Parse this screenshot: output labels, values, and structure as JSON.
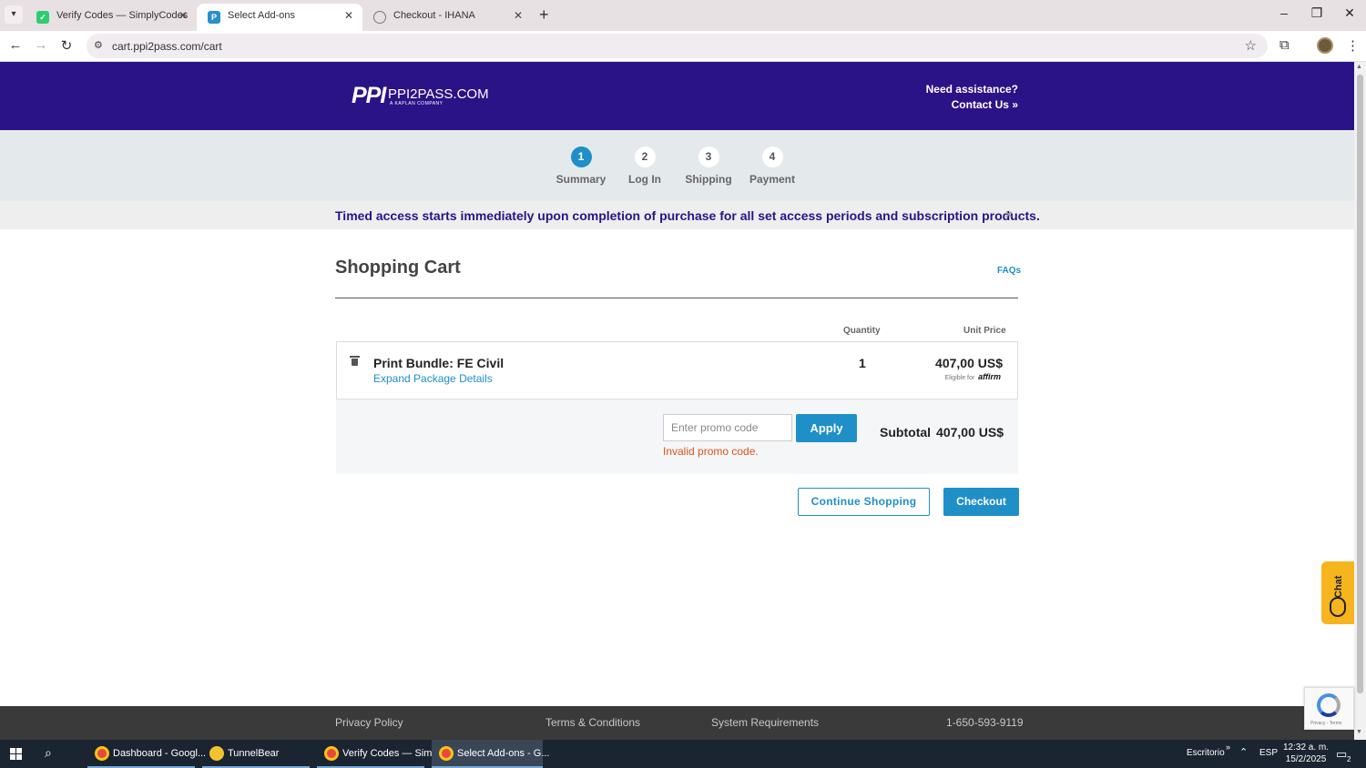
{
  "browser": {
    "tabs": [
      {
        "title": "Verify Codes — SimplyCodes",
        "active": false
      },
      {
        "title": "Select Add-ons",
        "active": true
      },
      {
        "title": "Checkout - IHANA",
        "active": false
      }
    ],
    "url": "cart.ppi2pass.com/cart"
  },
  "header": {
    "logo_mark": "PPI",
    "logo_text": "PPI2PASS.COM",
    "logo_sub": "A KAPLAN COMPANY",
    "assist_title": "Need assistance?",
    "contact_link": "Contact Us »"
  },
  "steps": [
    {
      "num": "1",
      "label": "Summary",
      "active": true
    },
    {
      "num": "2",
      "label": "Log In",
      "active": false
    },
    {
      "num": "3",
      "label": "Shipping",
      "active": false
    },
    {
      "num": "4",
      "label": "Payment",
      "active": false
    }
  ],
  "notice": {
    "text": "Timed access starts immediately upon completion of purchase for all set access periods and subscription products.",
    "close": "×"
  },
  "cart": {
    "title": "Shopping Cart",
    "faqs": "FAQs",
    "col_quantity": "Quantity",
    "col_unit_price": "Unit Price",
    "item": {
      "name": "Print Bundle: FE Civil",
      "expand": "Expand Package Details",
      "quantity": "1",
      "price": "407,00 US$",
      "affirm_prefix": "Eligible for",
      "affirm_brand": "affirm"
    },
    "promo": {
      "placeholder": "Enter promo code",
      "apply": "Apply",
      "error": "Invalid promo code."
    },
    "subtotal_label": "Subtotal",
    "subtotal_value": "407,00 US$",
    "continue": "Continue Shopping",
    "checkout": "Checkout"
  },
  "chat": {
    "label": "Chat"
  },
  "footer": {
    "privacy": "Privacy Policy",
    "terms": "Terms & Conditions",
    "system": "System Requirements",
    "phone": "1-650-593-9119"
  },
  "recaptcha": {
    "footer": "Privacy - Terms"
  },
  "taskbar": {
    "items": [
      {
        "label": "Dashboard - Googl...",
        "active": false
      },
      {
        "label": "TunnelBear",
        "active": false
      },
      {
        "label": "Verify Codes — Sim...",
        "active": false
      },
      {
        "label": "Select Add-ons - G...",
        "active": true
      }
    ],
    "desktop": "Escritorio",
    "lang": "ESP",
    "time": "12:32 a. m.",
    "date": "15/2/2025",
    "notif_count": "2"
  },
  "colors": {
    "header_bg": "#2a1386",
    "accent": "#1f8fc8",
    "error": "#d9531e",
    "chat": "#f6b41e"
  }
}
